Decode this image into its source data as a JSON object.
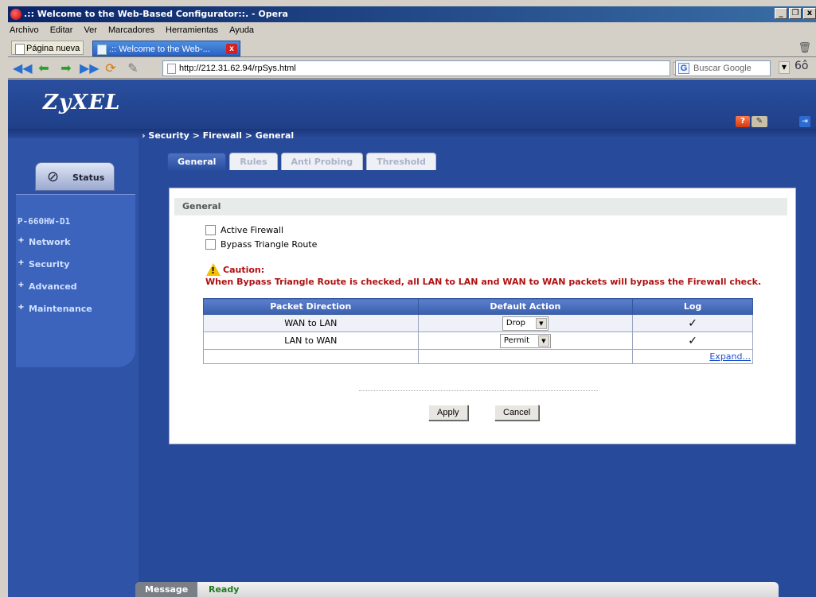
{
  "window": {
    "title": ".:: Welcome to the Web-Based Configurator::. - Opera",
    "controls": [
      "_",
      "❐",
      "x"
    ]
  },
  "menubar": [
    "Archivo",
    "Editar",
    "Ver",
    "Marcadores",
    "Herramientas",
    "Ayuda"
  ],
  "tabs": {
    "new_page": "Página nueva",
    "active": ".:: Welcome to the Web-...",
    "close": "x"
  },
  "address": {
    "url": "http://212.31.62.94/rpSys.html",
    "search_placeholder": "Buscar Google",
    "search_engine_glyph": "G",
    "dropdown_glyph": "▼",
    "zoom_glyph": "6ô"
  },
  "nav_icons": [
    "rewind-icon",
    "back-icon",
    "forward-icon",
    "fast-forward-icon",
    "reload-icon",
    "edit-icon"
  ],
  "header": {
    "logo": "ZyXEL",
    "help_glyph": "?",
    "wizard_glyph": "✎",
    "logout_glyph": "⇥"
  },
  "sidebar": {
    "status_label": "Status",
    "status_glyph": "⊘",
    "model": "P-660HW-D1",
    "items": [
      {
        "label": "Network"
      },
      {
        "label": "Security"
      },
      {
        "label": "Advanced"
      },
      {
        "label": "Maintenance"
      }
    ]
  },
  "breadcrumb": "Security > Firewall > General",
  "breadcrumb_glyph": "›",
  "page_tabs": [
    "General",
    "Rules",
    "Anti Probing",
    "Threshold"
  ],
  "general": {
    "section_title": "General",
    "active_firewall": "Active Firewall",
    "bypass_triangle": "Bypass Triangle Route",
    "caution_title": "Caution:",
    "caution_text": "When Bypass Triangle Route is checked, all LAN to LAN and WAN to WAN packets will bypass the Firewall check."
  },
  "table": {
    "headers": [
      "Packet Direction",
      "Default Action",
      "Log"
    ],
    "rows": [
      {
        "direction": "WAN to LAN",
        "action": "Drop",
        "log": "✓"
      },
      {
        "direction": "LAN to WAN",
        "action": "Permit",
        "log": "✓"
      }
    ],
    "expand": "Expand...",
    "select_arrow": "▼"
  },
  "buttons": {
    "apply": "Apply",
    "cancel": "Cancel"
  },
  "footer": {
    "label": "Message",
    "text": "Ready"
  },
  "colors": {
    "brand_blue": "#284a9a",
    "caution_red": "#b01010",
    "ready_green": "#1f7a23"
  }
}
